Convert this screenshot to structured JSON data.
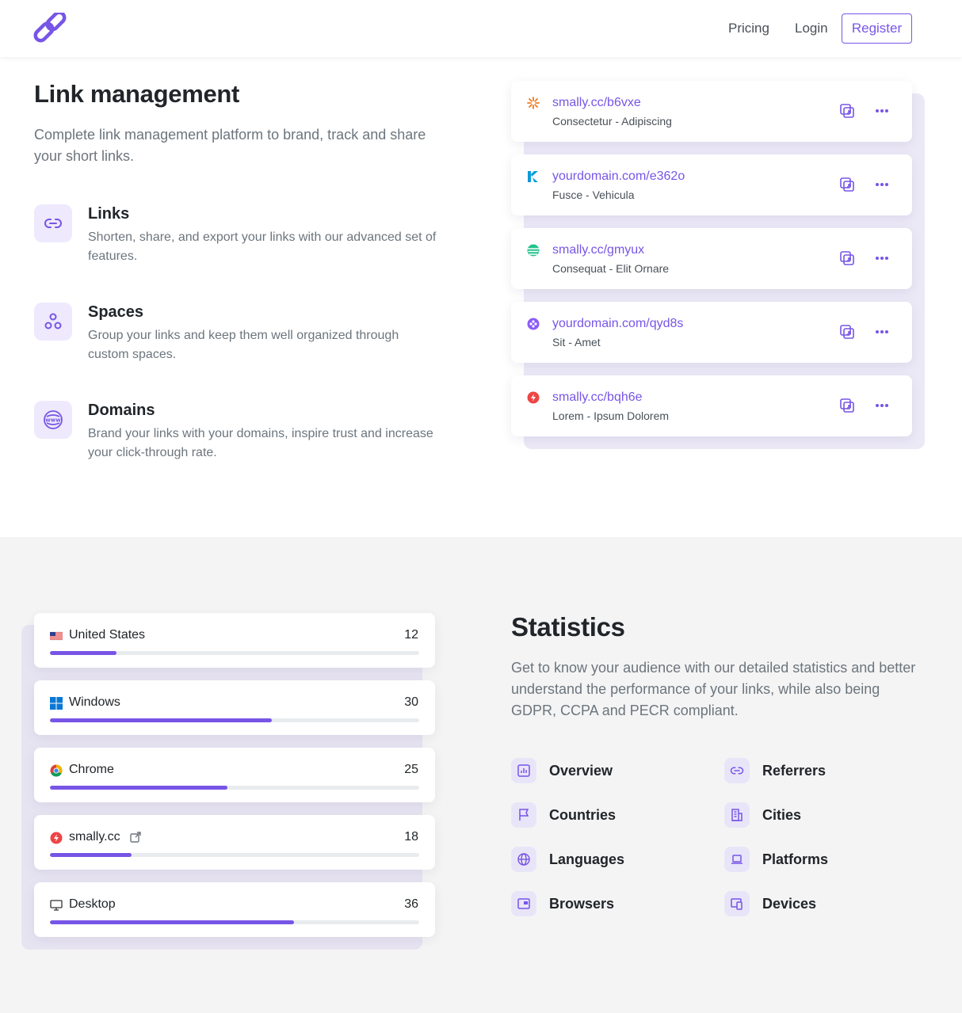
{
  "nav": {
    "pricing": "Pricing",
    "login": "Login",
    "register": "Register"
  },
  "hero": {
    "title": "Link management",
    "description": "Complete link management platform to brand, track and share your short links.",
    "features": [
      {
        "icon": "link-icon",
        "title": "Links",
        "text": "Shorten, share, and export your links with our advanced set of features."
      },
      {
        "icon": "spaces-icon",
        "title": "Spaces",
        "text": "Group your links and keep them well organized through custom spaces."
      },
      {
        "icon": "www-icon",
        "title": "Domains",
        "text": "Brand your links with your domains, inspire trust and increase your click-through rate."
      }
    ]
  },
  "links": [
    {
      "icon": "orange-burst-icon",
      "url": "smally.cc/b6vxe",
      "subtitle": "Consectetur - Adipiscing"
    },
    {
      "icon": "blue-k-logo-icon",
      "url": "yourdomain.com/e362o",
      "subtitle": "Fusce - Vehicula"
    },
    {
      "icon": "green-sphere-icon",
      "url": "smally.cc/gmyux",
      "subtitle": "Consequat - Elit Ornare"
    },
    {
      "icon": "purple-flower-icon",
      "url": "yourdomain.com/qyd8s",
      "subtitle": "Sit - Amet"
    },
    {
      "icon": "red-bolt-icon",
      "url": "smally.cc/bqh6e",
      "subtitle": "Lorem - Ipsum Dolorem"
    }
  ],
  "stats": {
    "title": "Statistics",
    "description": "Get to know your audience with our detailed statistics and better understand the performance of your links, while also being GDPR, CCPA and PECR compliant.",
    "rows": [
      {
        "icon": "us-flag-icon",
        "name": "United States",
        "value": "12",
        "progress": 0.18
      },
      {
        "icon": "windows-icon",
        "name": "Windows",
        "value": "30",
        "progress": 0.6
      },
      {
        "icon": "chrome-icon",
        "name": "Chrome",
        "value": "25",
        "progress": 0.48
      },
      {
        "icon": "red-bolt-icon",
        "name": "smally.cc",
        "value": "18",
        "progress": 0.22,
        "external": true
      },
      {
        "icon": "desktop-icon",
        "name": "Desktop",
        "value": "36",
        "progress": 0.66
      }
    ],
    "features": [
      {
        "icon": "bar-chart-icon",
        "label": "Overview"
      },
      {
        "icon": "link-icon",
        "label": "Referrers"
      },
      {
        "icon": "flag-icon",
        "label": "Countries"
      },
      {
        "icon": "building-icon",
        "label": "Cities"
      },
      {
        "icon": "globe-icon",
        "label": "Languages"
      },
      {
        "icon": "laptop-icon",
        "label": "Platforms"
      },
      {
        "icon": "browser-window-icon",
        "label": "Browsers"
      },
      {
        "icon": "devices-icon",
        "label": "Devices"
      }
    ]
  },
  "colors": {
    "accent": "#7755e6",
    "accent_light": "#eee9fc",
    "section_bg": "#f4f4f4"
  }
}
